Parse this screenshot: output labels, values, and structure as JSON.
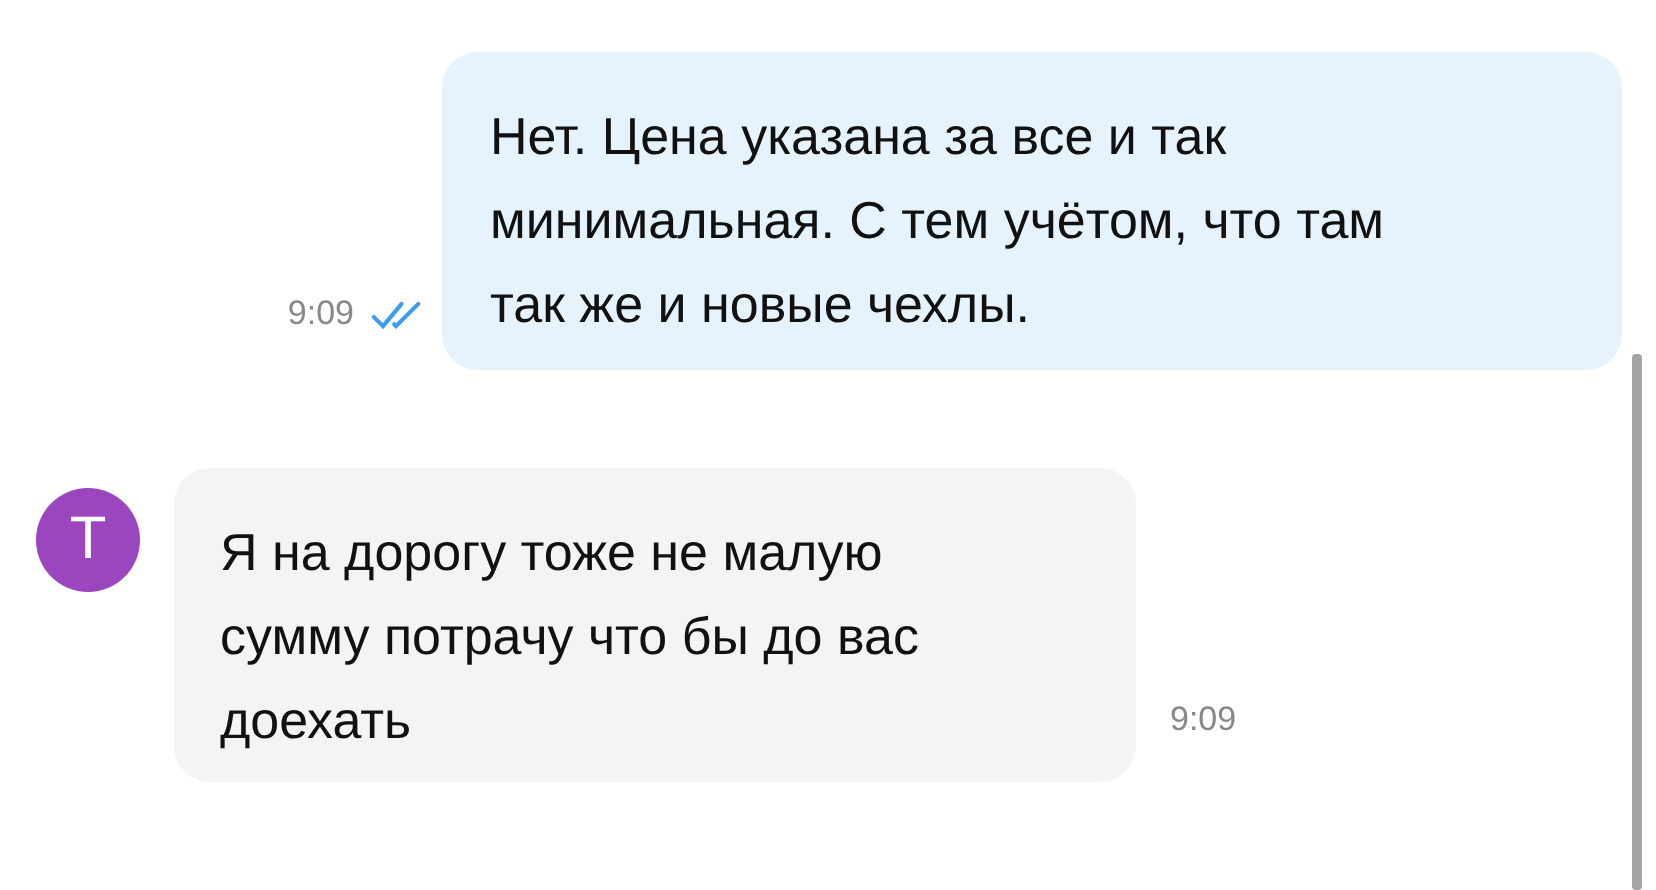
{
  "messages": [
    {
      "kind": "outgoing",
      "lines": [
        "Нет. Цена указана за все и так",
        "минимальная. С тем учётом, что там",
        "так же и новые чехлы."
      ],
      "time": "9:09",
      "read": true
    },
    {
      "kind": "incoming",
      "avatar": "T",
      "color": "#9b45be",
      "lines": [
        "Я на дорогу тоже не малую",
        "сумму потрачу что бы до вас",
        "доехать"
      ],
      "time": "9:09"
    }
  ]
}
